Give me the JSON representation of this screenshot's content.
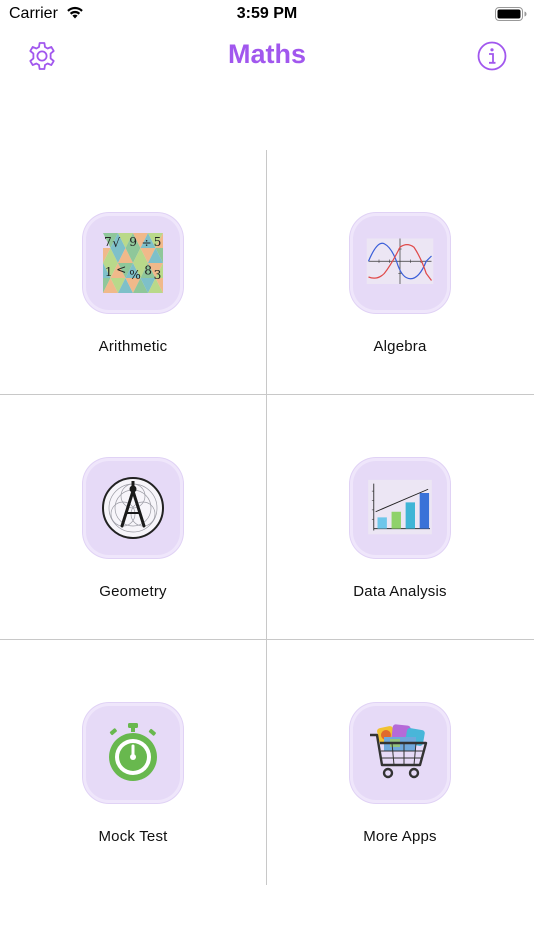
{
  "status_bar": {
    "carrier": "Carrier",
    "time": "3:59 PM",
    "wifi_icon": "wifi-icon",
    "battery_icon": "battery-icon"
  },
  "nav": {
    "title": "Maths",
    "left_icon": "gear-icon",
    "right_icon": "info-icon",
    "accent_color": "#a157ee"
  },
  "grid": {
    "items": [
      {
        "label": "Arithmetic",
        "icon": "arithmetic-tiles-icon"
      },
      {
        "label": "Algebra",
        "icon": "sine-graph-icon"
      },
      {
        "label": "Geometry",
        "icon": "compass-icon"
      },
      {
        "label": "Data Analysis",
        "icon": "bar-chart-icon"
      },
      {
        "label": "Mock Test",
        "icon": "stopwatch-icon"
      },
      {
        "label": "More Apps",
        "icon": "shopping-cart-icon"
      }
    ],
    "arithmetic_symbols": [
      "7",
      "√",
      "9",
      "÷",
      "5",
      "1",
      "<",
      "%",
      "8",
      "3"
    ],
    "tile_color": "#e6daf7"
  }
}
